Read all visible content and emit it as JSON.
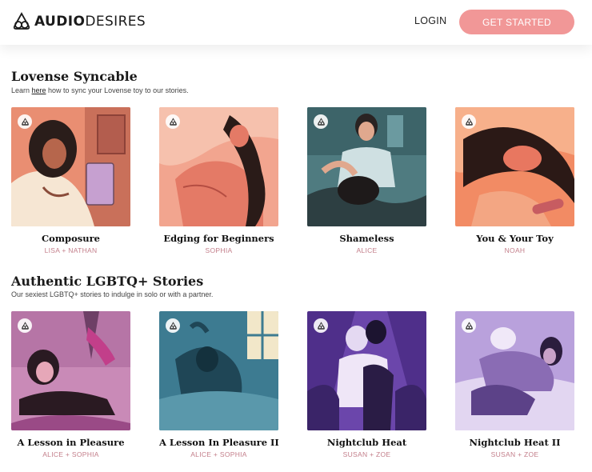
{
  "header": {
    "logo_bold": "AUDIO",
    "logo_light": "DESIRES",
    "login_label": "LOGIN",
    "cta_label": "GET STARTED",
    "cta_color": "#f19797"
  },
  "sections": [
    {
      "title": "Lovense Syncable",
      "subtitle_prefix": "Learn ",
      "subtitle_link": "here",
      "subtitle_suffix": " how to sync your Lovense toy to our stories.",
      "stories": [
        {
          "title": "Composure",
          "authors": "LISA + NATHAN",
          "icon": "lovense-badge-icon"
        },
        {
          "title": "Edging for Beginners",
          "authors": "SOPHIA",
          "icon": "lovense-badge-icon"
        },
        {
          "title": "Shameless",
          "authors": "ALICE",
          "icon": "lovense-badge-icon"
        },
        {
          "title": "You & Your Toy",
          "authors": "NOAH",
          "icon": "lovense-badge-icon"
        }
      ]
    },
    {
      "title": "Authentic LGBTQ+ Stories",
      "subtitle": "Our sexiest LGBTQ+ stories to indulge in solo or with a partner.",
      "stories": [
        {
          "title": "A Lesson in Pleasure",
          "authors": "ALICE + SOPHIA",
          "icon": "lovense-badge-icon"
        },
        {
          "title": "A Lesson In Pleasure II",
          "authors": "ALICE + SOPHIA",
          "icon": "lovense-badge-icon"
        },
        {
          "title": "Nightclub Heat",
          "authors": "SUSAN + ZOE",
          "icon": "lovense-badge-icon"
        },
        {
          "title": "Nightclub Heat II",
          "authors": "SUSAN + ZOE",
          "icon": "lovense-badge-icon"
        }
      ]
    }
  ],
  "colors": {
    "author_text": "#c37e8a"
  }
}
